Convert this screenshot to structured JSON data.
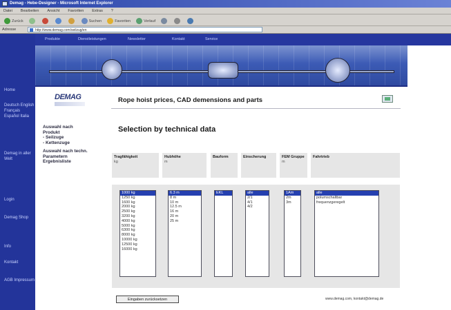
{
  "window": {
    "title": "Demag - Hebe-Designer - Microsoft Internet Explorer"
  },
  "menubar": [
    "Datei",
    "Bearbeiten",
    "Ansicht",
    "Favoriten",
    "Extras",
    "?"
  ],
  "toolbar": {
    "back": "Zurück",
    "search": "Suchen",
    "favorites": "Favoriten",
    "history": "Verlauf"
  },
  "address": {
    "label": "Adresse",
    "url": "http://www.demag.com/seilzug/en"
  },
  "leftnav": [
    "Home",
    "Deutsch English Français Español Italia",
    "Demag in aller Welt",
    "Login",
    "Demag Shop",
    "Info",
    "Kontakt",
    "AGB Impressum"
  ],
  "topnav": [
    "Produkte",
    "Dienstleistungen",
    "Newsletter",
    "Kontakt",
    "Service"
  ],
  "brand": {
    "logo": "DEMAG"
  },
  "page": {
    "title": "Rope hoist prices, CAD demensions and parts",
    "section": "Selection by technical data"
  },
  "sidemenu": {
    "item1_line1": "Auswahl nach",
    "item1_line2": "Produkt",
    "item1_sub1": "- Seilzuge",
    "item1_sub2": "- Kettenzuge",
    "item2_line1": "Auswahl nach techn.",
    "item2_line2": "Parametern",
    "item3": "Ergebnisliste"
  },
  "columns": [
    {
      "label": "Tragfähigkeit",
      "unit": "kg"
    },
    {
      "label": "Hubhöhe",
      "unit": "m"
    },
    {
      "label": "Bauform",
      "unit": ""
    },
    {
      "label": "Einscherung",
      "unit": ""
    },
    {
      "label": "FEM Gruppe",
      "unit": "m"
    },
    {
      "label": "Fahrtrieb",
      "unit": ""
    }
  ],
  "lists": {
    "capacity": [
      "1000 kg",
      "1250 kg",
      "1600 kg",
      "2000 kg",
      "2500 kg",
      "3200 kg",
      "4000 kg",
      "5000 kg",
      "6300 kg",
      "8000 kg",
      "10000 kg",
      "12500 kg",
      "16000 kg"
    ],
    "height": [
      "6.3 m",
      "8 m",
      "10 m",
      "12.5 m",
      "16 m",
      "20 m",
      "25 m"
    ],
    "design": [
      "EKL"
    ],
    "reeving": [
      "alle",
      "2/1",
      "4/1",
      "4/2"
    ],
    "fem": [
      "1Am",
      "2m",
      "3m"
    ],
    "travel": [
      "alle",
      "polumschaltbar",
      "frequenzgeregelt"
    ]
  },
  "buttons": {
    "reset": "Eingaben zurücksetzen"
  },
  "footer": {
    "text": "www.demag.com, kontakt@demag.de"
  }
}
